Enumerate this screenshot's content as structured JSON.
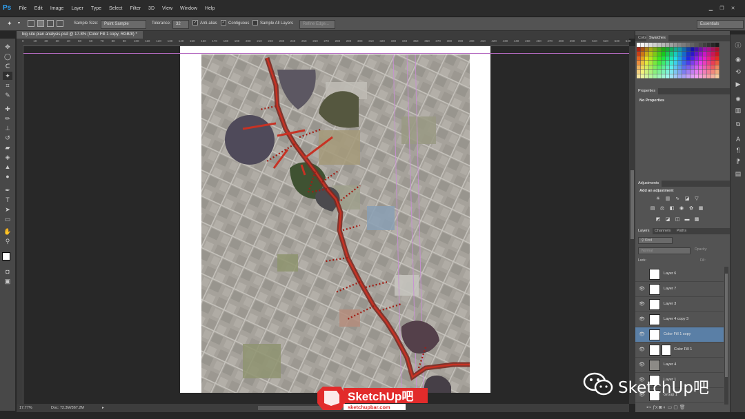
{
  "app": {
    "logo": "Ps"
  },
  "menu": [
    "File",
    "Edit",
    "Image",
    "Layer",
    "Type",
    "Select",
    "Filter",
    "3D",
    "View",
    "Window",
    "Help"
  ],
  "window_buttons": [
    "minimize-icon",
    "restore-icon",
    "close-icon"
  ],
  "options": {
    "sample_size_label": "Sample Size:",
    "sample_size_value": "Point Sample",
    "tolerance_label": "Tolerance:",
    "tolerance_value": "32",
    "anti_alias": "Anti-alias",
    "contiguous": "Contiguous",
    "sample_all_layers": "Sample All Layers",
    "refine_edge": "Refine Edge...",
    "workspace": "Essentials"
  },
  "document": {
    "tab": "big site plan analysis.psd @ 17.8% (Color Fill 1 copy, RGB/8) *",
    "zoom": "17.77%",
    "doc_size": "Doc: 72.3M/367.2M"
  },
  "ruler_ticks": [
    "0",
    "10",
    "20",
    "30",
    "40",
    "50",
    "60",
    "70",
    "80",
    "90",
    "100",
    "110",
    "120",
    "130",
    "140",
    "150",
    "160",
    "170",
    "180",
    "190",
    "200",
    "210",
    "220",
    "230",
    "240",
    "250",
    "260",
    "270",
    "280",
    "290",
    "300",
    "310",
    "320",
    "330",
    "340",
    "350",
    "360",
    "370",
    "380",
    "390",
    "400",
    "410",
    "420",
    "430",
    "440",
    "450",
    "460",
    "470",
    "480",
    "490",
    "500",
    "510",
    "520",
    "530",
    "540"
  ],
  "swatches_panel": {
    "tabs": [
      "Color",
      "Swatches"
    ]
  },
  "properties_panel": {
    "tab": "Properties",
    "text": "No Properties"
  },
  "adjustments_panel": {
    "tab": "Adjustments",
    "title": "Add an adjustment"
  },
  "layers_panel": {
    "tabs": [
      "Layers",
      "Channels",
      "Paths"
    ],
    "kind": "Kind",
    "blend": "Normal",
    "opacity_label": "Opacity:",
    "lock_label": "Lock:",
    "fill_label": "Fill:",
    "layers": [
      {
        "name": "Layer 6",
        "visible": false
      },
      {
        "name": "Layer 7",
        "visible": true
      },
      {
        "name": "Layer 3",
        "visible": true
      },
      {
        "name": "Layer 4 copy 3",
        "visible": true
      },
      {
        "name": "Color Fill 1 copy",
        "visible": true,
        "selected": true
      },
      {
        "name": "Color Fill 1",
        "visible": true
      },
      {
        "name": "Layer 4",
        "visible": true
      },
      {
        "name": "Layer 1",
        "visible": true
      },
      {
        "name": "Group 1",
        "visible": true
      }
    ]
  },
  "watermark": {
    "logo_text": "SketchUp吧",
    "logo_url": "sketchupbar.com",
    "right_text": "SketchUp吧"
  },
  "colors": {
    "accent": "#2fa3f7",
    "route": "#b3261e",
    "guide": "#b46ac0",
    "selected_layer": "#5a7fa6"
  }
}
